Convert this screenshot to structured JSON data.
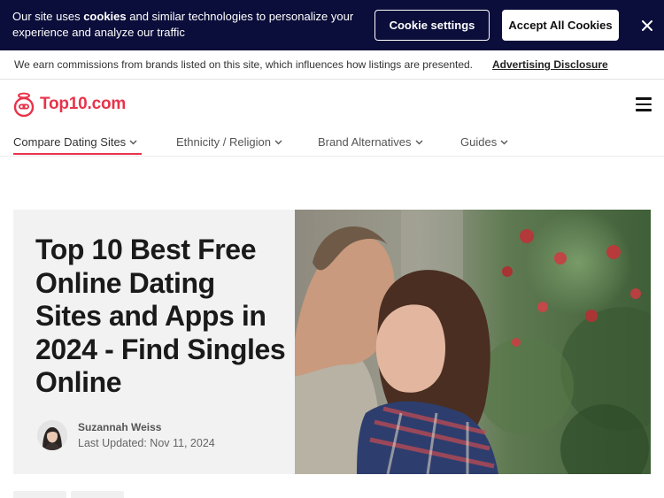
{
  "cookie_banner": {
    "text_before": "Our site uses ",
    "text_bold": "cookies",
    "text_after": " and similar technologies to personalize your experience and analyze our traffic",
    "settings_label": "Cookie settings",
    "accept_label": "Accept All Cookies",
    "close_icon": "close-icon"
  },
  "disclosure": {
    "text": "We earn commissions from brands listed on this site, which influences how listings are presented.",
    "link_label": "Advertising Disclosure"
  },
  "header": {
    "logo_text": "Top10.com",
    "menu_icon": "hamburger-menu-icon"
  },
  "nav": {
    "items": [
      {
        "label": "Compare Dating Sites"
      },
      {
        "label": "Ethnicity / Religion"
      },
      {
        "label": "Brand Alternatives"
      },
      {
        "label": "Guides"
      }
    ]
  },
  "hero": {
    "title": "Top 10 Best Free Online Dating Sites and Apps in 2024 - Find Singles Online",
    "author_name": "Suzannah Weiss",
    "updated": "Last Updated: Nov 11, 2024"
  },
  "colors": {
    "brand": "#e8334a",
    "cookie_bg": "#0b0d3a"
  }
}
